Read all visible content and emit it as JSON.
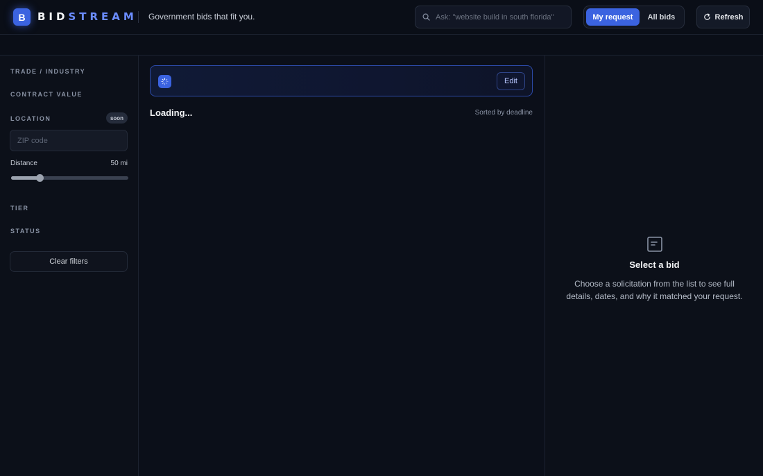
{
  "header": {
    "logo_letter": "B",
    "brand_part1": "BID",
    "brand_part2": "STREAM",
    "tagline": "Government bids that fit you.",
    "search_placeholder": "Ask: \"website build in south florida\"",
    "toggle": {
      "active": "My request",
      "inactive": "All bids"
    },
    "refresh_label": "Refresh",
    "accent_color": "#3b63e0"
  },
  "sidebar": {
    "sections": {
      "trade": "TRADE / INDUSTRY",
      "contract_value": "CONTRACT VALUE",
      "location": "LOCATION",
      "tier": "TIER",
      "status": "STATUS"
    },
    "location_badge": "soon",
    "zip_placeholder": "ZIP code",
    "distance_label": "Distance",
    "distance_value": "50 mi",
    "distance_fraction": 0.24,
    "clear_label": "Clear filters"
  },
  "main": {
    "edit_label": "Edit",
    "loading_text": "Loading...",
    "sort_text": "Sorted by deadline"
  },
  "detail": {
    "icon": "document-icon",
    "title": "Select a bid",
    "description": "Choose a solicitation from the list to see full details, dates, and why it matched your request."
  }
}
